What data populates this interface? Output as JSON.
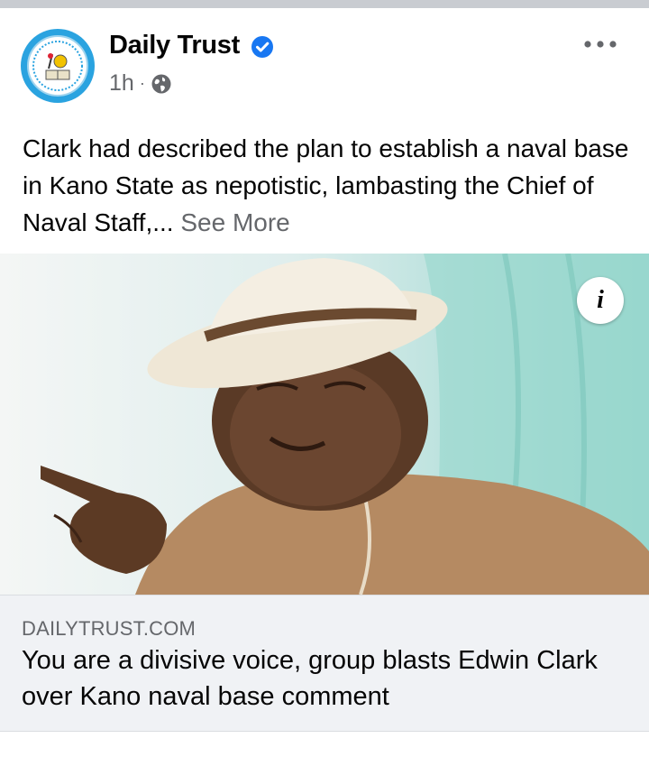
{
  "post": {
    "page_name": "Daily Trust",
    "time": "1h",
    "separator": "·",
    "text_main": "Clark had described the plan to establish a naval base in Kano State as nepotistic, lambasting the Chief of Naval Staff,...",
    "see_more": "See More"
  },
  "link": {
    "domain": "DAILYTRUST.COM",
    "headline": "You are a divisive voice, group blasts Edwin Clark over Kano naval base comment"
  },
  "icons": {
    "verified": "verified-badge-icon",
    "privacy": "globe-icon",
    "more": "more-options-icon",
    "info": "info-icon"
  },
  "info_glyph": "i",
  "colors": {
    "verified_blue": "#1877f2",
    "secondary_text": "#65676b",
    "link_bg": "#f0f2f5"
  }
}
